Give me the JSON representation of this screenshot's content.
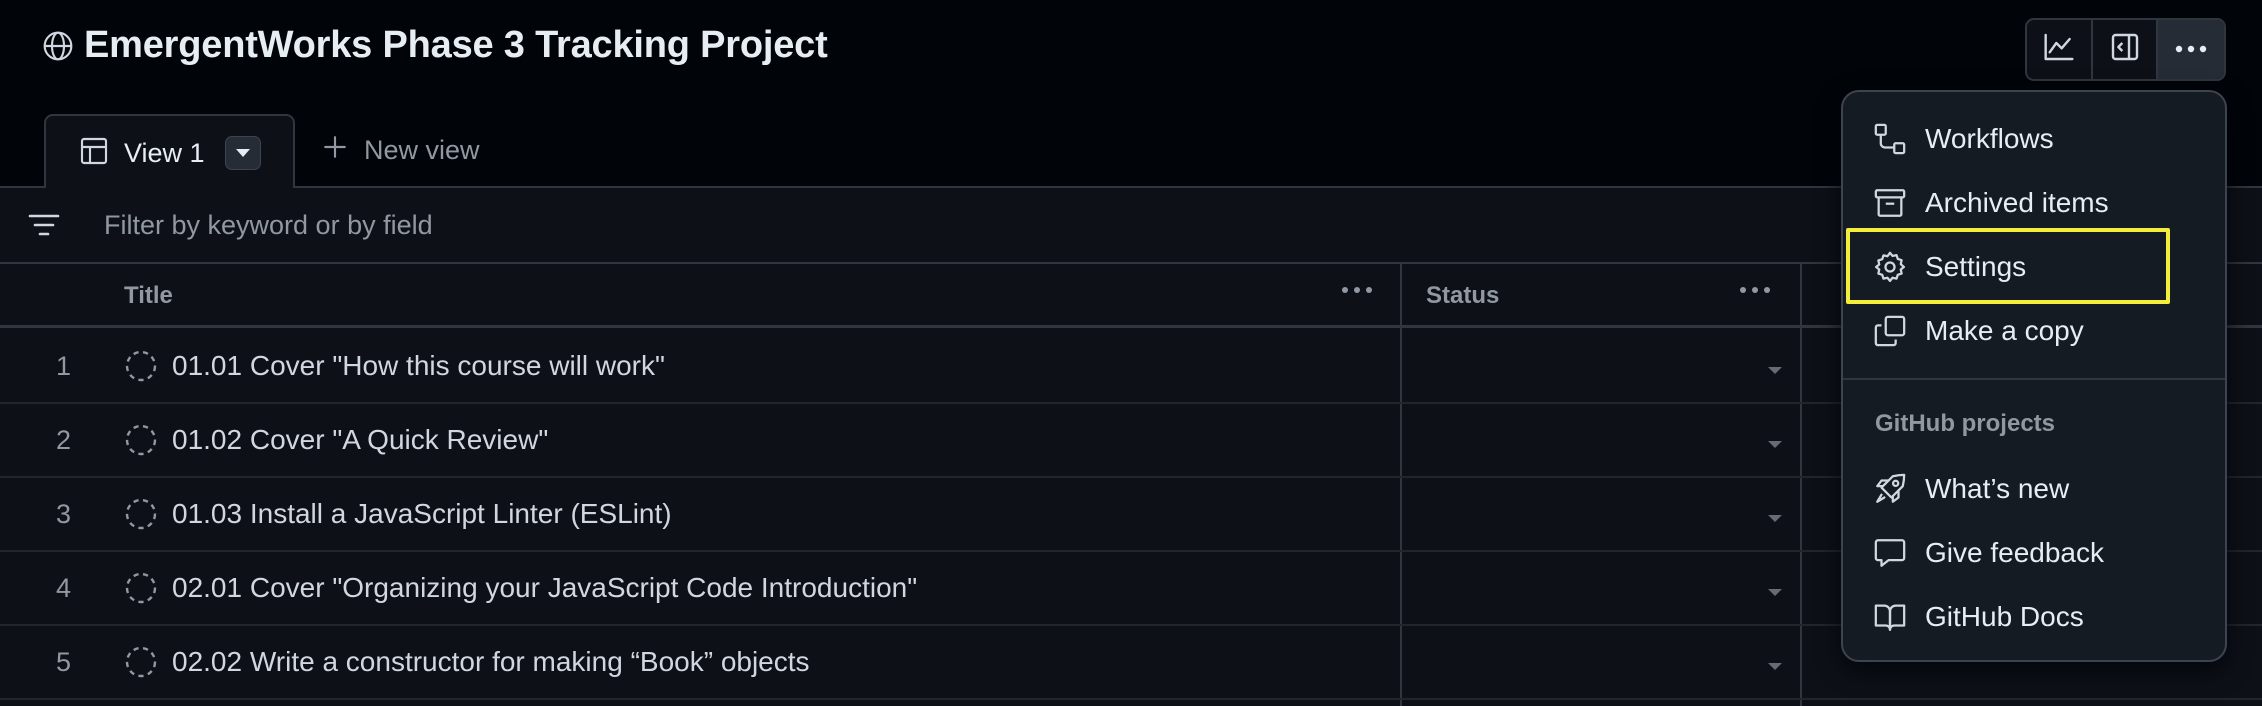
{
  "header": {
    "title": "EmergentWorks Phase 3 Tracking Project",
    "title_icon": "globe-icon",
    "actions": [
      {
        "name": "insights-button",
        "icon": "graph-icon"
      },
      {
        "name": "toggle-side-panel-button",
        "icon": "sidebar-expand-icon"
      },
      {
        "name": "more-options-button",
        "icon": "kebab-horizontal-icon"
      }
    ]
  },
  "tabs": {
    "active_label": "View 1",
    "new_view_label": "New view"
  },
  "filter": {
    "placeholder": "Filter by keyword or by field"
  },
  "table": {
    "columns": [
      "Title",
      "Status"
    ],
    "rows": [
      {
        "num": "1",
        "title": "01.01 Cover \"How this course will work\""
      },
      {
        "num": "2",
        "title": "01.02 Cover \"A Quick Review\""
      },
      {
        "num": "3",
        "title": "01.03 Install a JavaScript Linter (ESLint)"
      },
      {
        "num": "4",
        "title": "02.01 Cover \"Organizing your JavaScript Code Introduction\""
      },
      {
        "num": "5",
        "title": "02.02 Write a constructor for making “Book” objects"
      }
    ]
  },
  "menu": {
    "items": [
      {
        "label": "Workflows",
        "icon": "workflow-icon"
      },
      {
        "label": "Archived items",
        "icon": "archive-icon"
      },
      {
        "label": "Settings",
        "icon": "gear-icon",
        "highlighted": true
      },
      {
        "label": "Make a copy",
        "icon": "copy-icon"
      }
    ],
    "group_label": "GitHub projects",
    "group_items": [
      {
        "label": "What’s new",
        "icon": "rocket-icon"
      },
      {
        "label": "Give feedback",
        "icon": "comment-icon"
      },
      {
        "label": "GitHub Docs",
        "icon": "book-icon"
      }
    ]
  },
  "colors": {
    "background": "#010409",
    "surface": "#0d1117",
    "menu_bg": "#151b23",
    "border": "#30363d",
    "text": "#e6edf3",
    "muted": "#9198a1",
    "highlight": "#f2ee3b"
  }
}
